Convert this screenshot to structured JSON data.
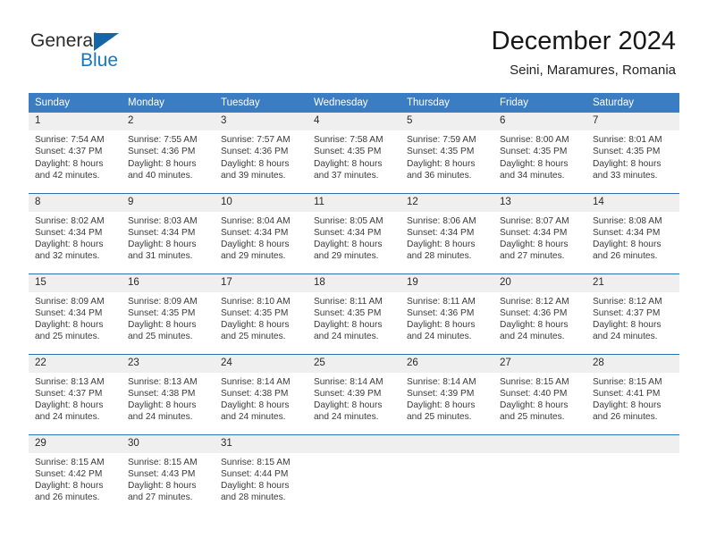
{
  "brand": {
    "name_primary": "General",
    "name_secondary": "Blue",
    "triangle_color": "#1565a8",
    "blue_color": "#1576c4"
  },
  "header": {
    "title": "December 2024",
    "subtitle": "Seini, Maramures, Romania"
  },
  "theme": {
    "header_bg": "#3a7dc2",
    "row_divider": "#2f6fae",
    "daynum_bg": "#efefef",
    "page_bg": "#ffffff"
  },
  "calendar": {
    "weekday_headers": [
      "Sunday",
      "Monday",
      "Tuesday",
      "Wednesday",
      "Thursday",
      "Friday",
      "Saturday"
    ],
    "weeks": [
      [
        {
          "day": "1",
          "sunrise": "Sunrise: 7:54 AM",
          "sunset": "Sunset: 4:37 PM",
          "daylight1": "Daylight: 8 hours",
          "daylight2": "and 42 minutes."
        },
        {
          "day": "2",
          "sunrise": "Sunrise: 7:55 AM",
          "sunset": "Sunset: 4:36 PM",
          "daylight1": "Daylight: 8 hours",
          "daylight2": "and 40 minutes."
        },
        {
          "day": "3",
          "sunrise": "Sunrise: 7:57 AM",
          "sunset": "Sunset: 4:36 PM",
          "daylight1": "Daylight: 8 hours",
          "daylight2": "and 39 minutes."
        },
        {
          "day": "4",
          "sunrise": "Sunrise: 7:58 AM",
          "sunset": "Sunset: 4:35 PM",
          "daylight1": "Daylight: 8 hours",
          "daylight2": "and 37 minutes."
        },
        {
          "day": "5",
          "sunrise": "Sunrise: 7:59 AM",
          "sunset": "Sunset: 4:35 PM",
          "daylight1": "Daylight: 8 hours",
          "daylight2": "and 36 minutes."
        },
        {
          "day": "6",
          "sunrise": "Sunrise: 8:00 AM",
          "sunset": "Sunset: 4:35 PM",
          "daylight1": "Daylight: 8 hours",
          "daylight2": "and 34 minutes."
        },
        {
          "day": "7",
          "sunrise": "Sunrise: 8:01 AM",
          "sunset": "Sunset: 4:35 PM",
          "daylight1": "Daylight: 8 hours",
          "daylight2": "and 33 minutes."
        }
      ],
      [
        {
          "day": "8",
          "sunrise": "Sunrise: 8:02 AM",
          "sunset": "Sunset: 4:34 PM",
          "daylight1": "Daylight: 8 hours",
          "daylight2": "and 32 minutes."
        },
        {
          "day": "9",
          "sunrise": "Sunrise: 8:03 AM",
          "sunset": "Sunset: 4:34 PM",
          "daylight1": "Daylight: 8 hours",
          "daylight2": "and 31 minutes."
        },
        {
          "day": "10",
          "sunrise": "Sunrise: 8:04 AM",
          "sunset": "Sunset: 4:34 PM",
          "daylight1": "Daylight: 8 hours",
          "daylight2": "and 29 minutes."
        },
        {
          "day": "11",
          "sunrise": "Sunrise: 8:05 AM",
          "sunset": "Sunset: 4:34 PM",
          "daylight1": "Daylight: 8 hours",
          "daylight2": "and 29 minutes."
        },
        {
          "day": "12",
          "sunrise": "Sunrise: 8:06 AM",
          "sunset": "Sunset: 4:34 PM",
          "daylight1": "Daylight: 8 hours",
          "daylight2": "and 28 minutes."
        },
        {
          "day": "13",
          "sunrise": "Sunrise: 8:07 AM",
          "sunset": "Sunset: 4:34 PM",
          "daylight1": "Daylight: 8 hours",
          "daylight2": "and 27 minutes."
        },
        {
          "day": "14",
          "sunrise": "Sunrise: 8:08 AM",
          "sunset": "Sunset: 4:34 PM",
          "daylight1": "Daylight: 8 hours",
          "daylight2": "and 26 minutes."
        }
      ],
      [
        {
          "day": "15",
          "sunrise": "Sunrise: 8:09 AM",
          "sunset": "Sunset: 4:34 PM",
          "daylight1": "Daylight: 8 hours",
          "daylight2": "and 25 minutes."
        },
        {
          "day": "16",
          "sunrise": "Sunrise: 8:09 AM",
          "sunset": "Sunset: 4:35 PM",
          "daylight1": "Daylight: 8 hours",
          "daylight2": "and 25 minutes."
        },
        {
          "day": "17",
          "sunrise": "Sunrise: 8:10 AM",
          "sunset": "Sunset: 4:35 PM",
          "daylight1": "Daylight: 8 hours",
          "daylight2": "and 25 minutes."
        },
        {
          "day": "18",
          "sunrise": "Sunrise: 8:11 AM",
          "sunset": "Sunset: 4:35 PM",
          "daylight1": "Daylight: 8 hours",
          "daylight2": "and 24 minutes."
        },
        {
          "day": "19",
          "sunrise": "Sunrise: 8:11 AM",
          "sunset": "Sunset: 4:36 PM",
          "daylight1": "Daylight: 8 hours",
          "daylight2": "and 24 minutes."
        },
        {
          "day": "20",
          "sunrise": "Sunrise: 8:12 AM",
          "sunset": "Sunset: 4:36 PM",
          "daylight1": "Daylight: 8 hours",
          "daylight2": "and 24 minutes."
        },
        {
          "day": "21",
          "sunrise": "Sunrise: 8:12 AM",
          "sunset": "Sunset: 4:37 PM",
          "daylight1": "Daylight: 8 hours",
          "daylight2": "and 24 minutes."
        }
      ],
      [
        {
          "day": "22",
          "sunrise": "Sunrise: 8:13 AM",
          "sunset": "Sunset: 4:37 PM",
          "daylight1": "Daylight: 8 hours",
          "daylight2": "and 24 minutes."
        },
        {
          "day": "23",
          "sunrise": "Sunrise: 8:13 AM",
          "sunset": "Sunset: 4:38 PM",
          "daylight1": "Daylight: 8 hours",
          "daylight2": "and 24 minutes."
        },
        {
          "day": "24",
          "sunrise": "Sunrise: 8:14 AM",
          "sunset": "Sunset: 4:38 PM",
          "daylight1": "Daylight: 8 hours",
          "daylight2": "and 24 minutes."
        },
        {
          "day": "25",
          "sunrise": "Sunrise: 8:14 AM",
          "sunset": "Sunset: 4:39 PM",
          "daylight1": "Daylight: 8 hours",
          "daylight2": "and 24 minutes."
        },
        {
          "day": "26",
          "sunrise": "Sunrise: 8:14 AM",
          "sunset": "Sunset: 4:39 PM",
          "daylight1": "Daylight: 8 hours",
          "daylight2": "and 25 minutes."
        },
        {
          "day": "27",
          "sunrise": "Sunrise: 8:15 AM",
          "sunset": "Sunset: 4:40 PM",
          "daylight1": "Daylight: 8 hours",
          "daylight2": "and 25 minutes."
        },
        {
          "day": "28",
          "sunrise": "Sunrise: 8:15 AM",
          "sunset": "Sunset: 4:41 PM",
          "daylight1": "Daylight: 8 hours",
          "daylight2": "and 26 minutes."
        }
      ],
      [
        {
          "day": "29",
          "sunrise": "Sunrise: 8:15 AM",
          "sunset": "Sunset: 4:42 PM",
          "daylight1": "Daylight: 8 hours",
          "daylight2": "and 26 minutes."
        },
        {
          "day": "30",
          "sunrise": "Sunrise: 8:15 AM",
          "sunset": "Sunset: 4:43 PM",
          "daylight1": "Daylight: 8 hours",
          "daylight2": "and 27 minutes."
        },
        {
          "day": "31",
          "sunrise": "Sunrise: 8:15 AM",
          "sunset": "Sunset: 4:44 PM",
          "daylight1": "Daylight: 8 hours",
          "daylight2": "and 28 minutes."
        },
        {
          "day": "",
          "sunrise": "",
          "sunset": "",
          "daylight1": "",
          "daylight2": ""
        },
        {
          "day": "",
          "sunrise": "",
          "sunset": "",
          "daylight1": "",
          "daylight2": ""
        },
        {
          "day": "",
          "sunrise": "",
          "sunset": "",
          "daylight1": "",
          "daylight2": ""
        },
        {
          "day": "",
          "sunrise": "",
          "sunset": "",
          "daylight1": "",
          "daylight2": ""
        }
      ]
    ]
  }
}
